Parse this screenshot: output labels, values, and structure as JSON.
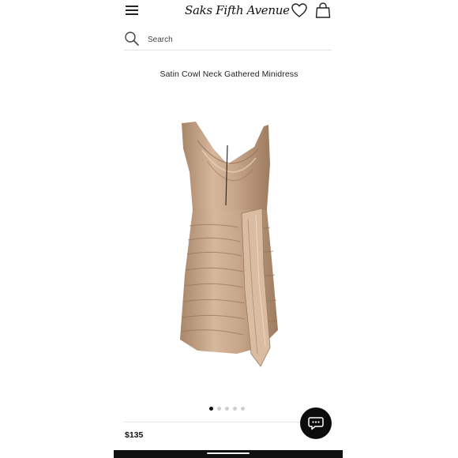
{
  "header": {
    "logo_text": "Saks Fifth Avenue",
    "icons": {
      "menu": "hamburger-menu-icon",
      "favorites": "heart-icon",
      "bag": "shopping-bag-icon"
    }
  },
  "search": {
    "placeholder": "Search",
    "icon": "search-icon"
  },
  "product": {
    "title": "Satin Cowl Neck Gathered Minidress",
    "price": "$135",
    "image": {
      "description_icon": "product-image",
      "color": "#c9a98d"
    },
    "gallery": {
      "count": 5,
      "active_index": 1
    }
  },
  "chat": {
    "icon": "chat-bubble-icon"
  },
  "colors": {
    "text": "#111111",
    "dress": "#c9a98d",
    "chat_bg": "#0c0c0c",
    "bar": "#111111"
  }
}
